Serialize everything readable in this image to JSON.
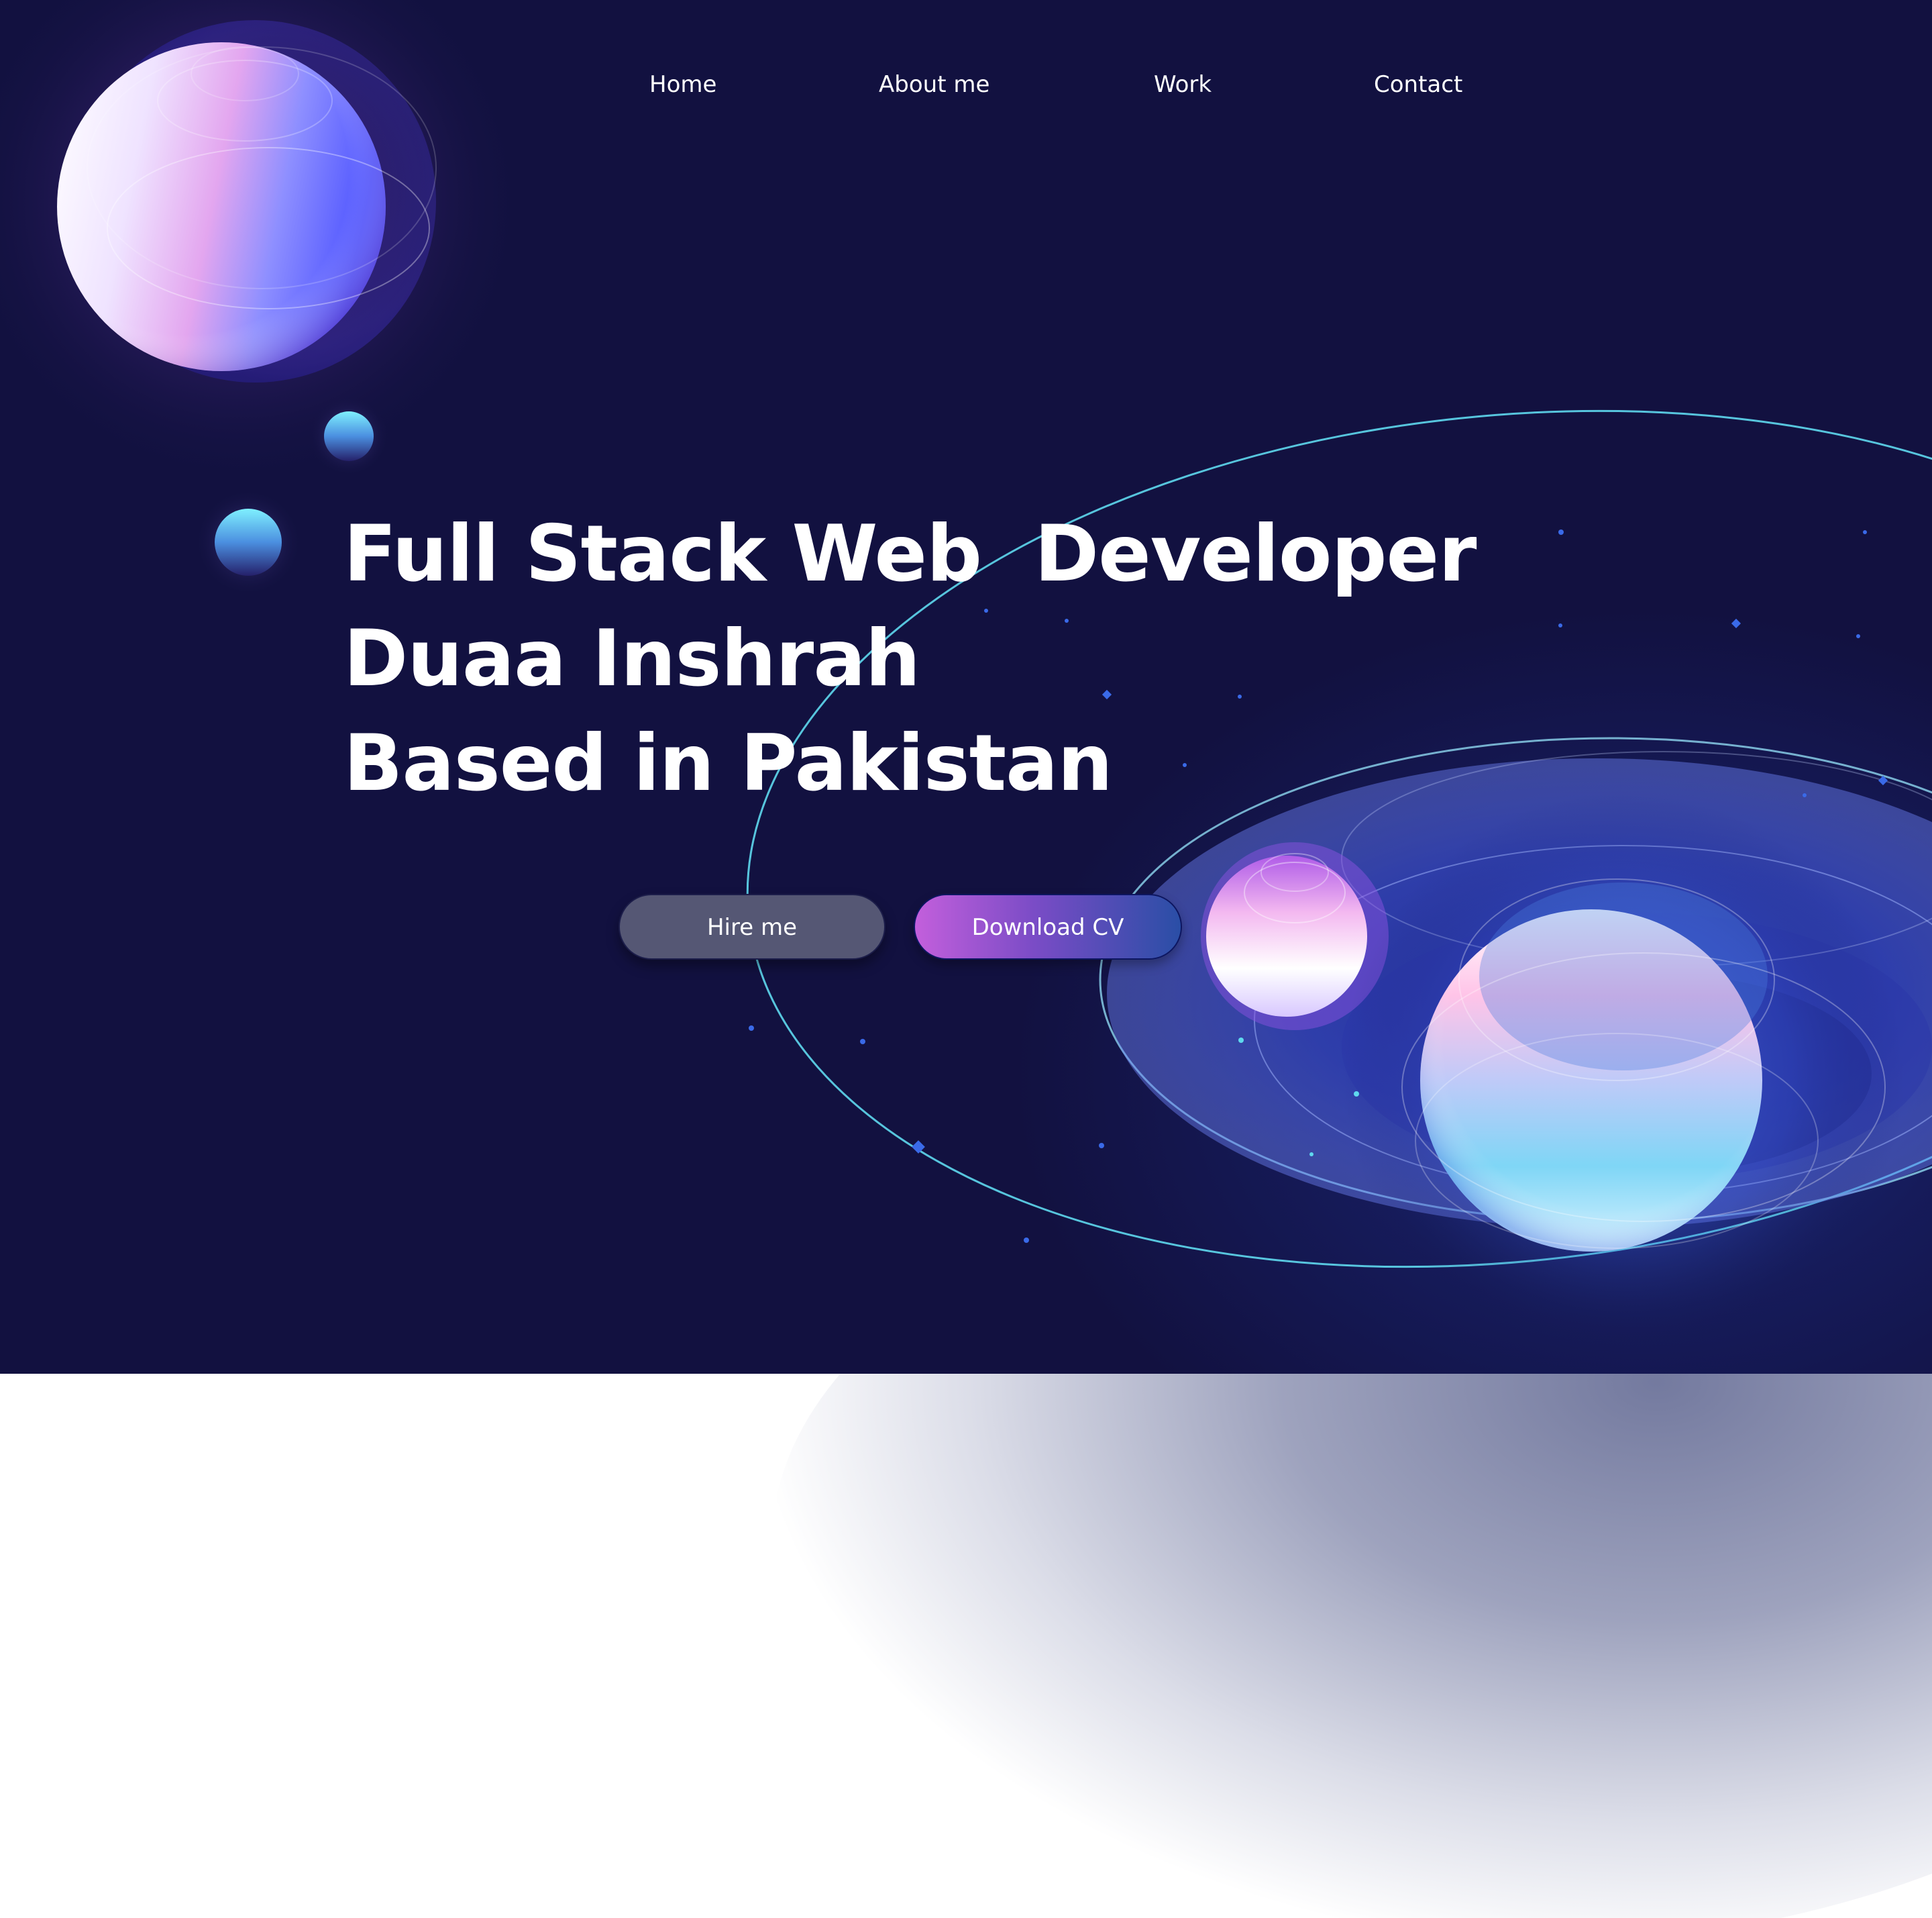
{
  "nav": {
    "items": [
      {
        "label": "Home"
      },
      {
        "label": "About me"
      },
      {
        "label": "Work"
      },
      {
        "label": "Contact"
      }
    ]
  },
  "hero": {
    "headline_lines": [
      "Full Stack Web  Developer",
      "Duaa Inshrah",
      "Based in Pakistan"
    ],
    "buttons": {
      "hire_label": "Hire me",
      "cv_label": "Download CV"
    }
  },
  "colors": {
    "background": "#121140",
    "hire_button": "#555774",
    "cv_gradient_start": "#c35fdc",
    "cv_gradient_end": "#2a4ea6",
    "orbit_line": "#5fd9ee",
    "text": "#ffffff"
  }
}
